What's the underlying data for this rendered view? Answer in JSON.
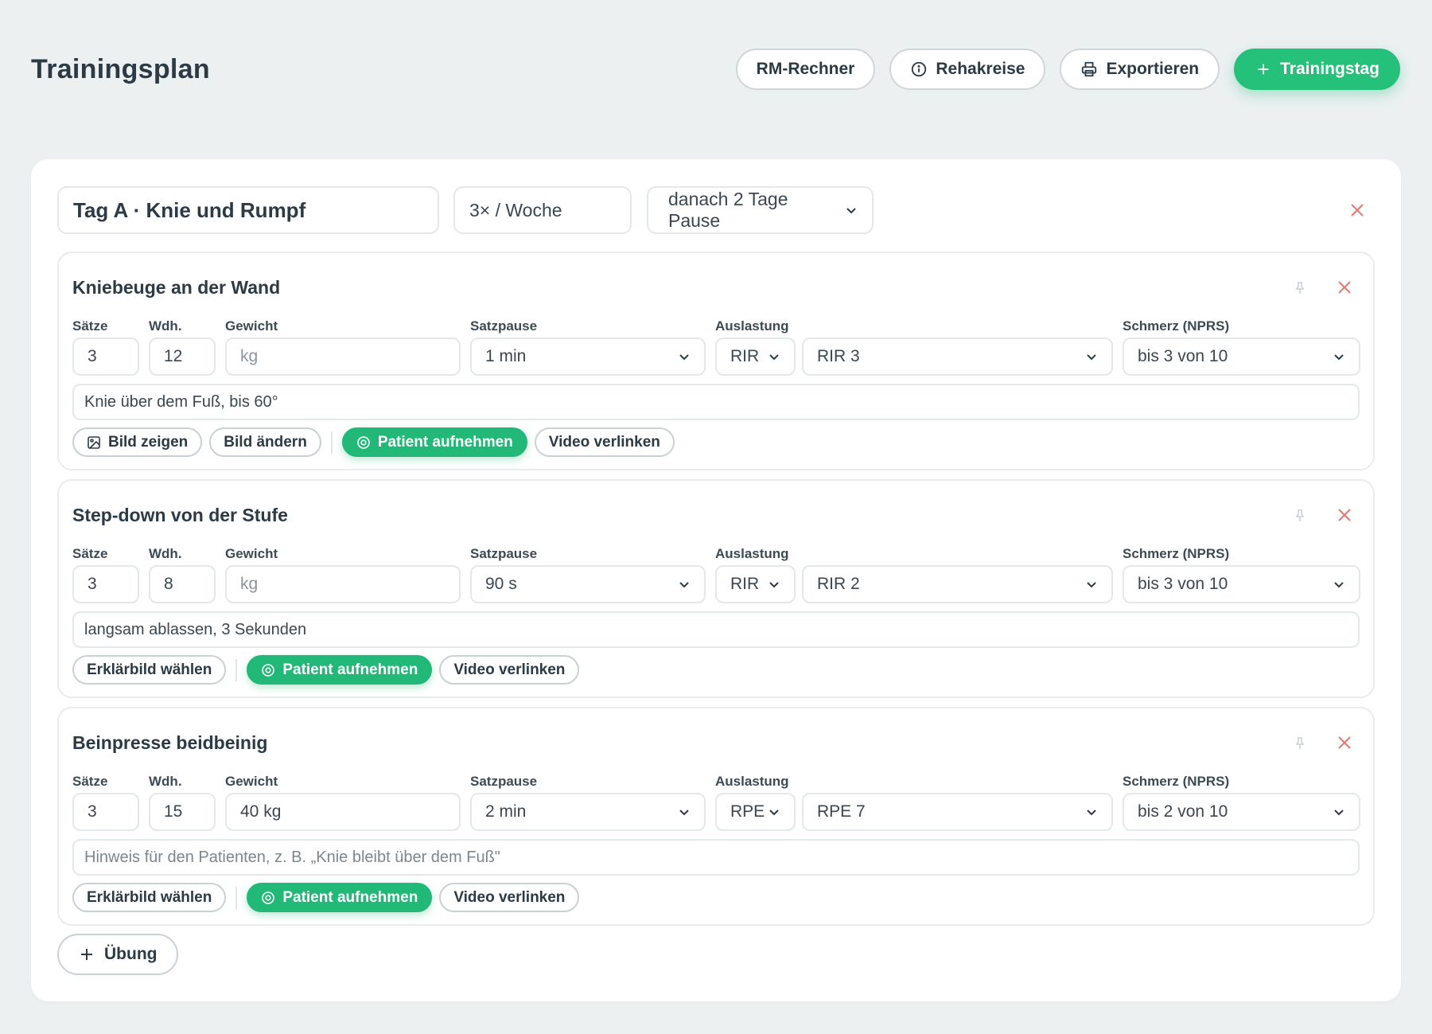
{
  "header": {
    "title": "Trainingsplan",
    "buttons": {
      "rm": "RM-Rechner",
      "rehakreise": "Rehakreise",
      "export": "Exportieren",
      "add_day": "Trainingstag"
    }
  },
  "day": {
    "name": "Tag A · Knie und Rumpf",
    "frequency": "3× / Woche",
    "pause": "danach 2 Tage Pause"
  },
  "labels": {
    "sets": "Sätze",
    "reps": "Wdh.",
    "weight": "Gewicht",
    "rest": "Satzpause",
    "load": "Auslastung",
    "pain": "Schmerz (NPRS)"
  },
  "exercises": [
    {
      "title": "Kniebeuge an der Wand",
      "sets": "3",
      "reps": "12",
      "weight": "",
      "weight_placeholder": "kg",
      "rest": "1 min",
      "load_type": "RIR",
      "load_value": "RIR 3",
      "pain": "bis 3 von 10",
      "note": "Knie über dem Fuß, bis 60°",
      "note_placeholder": "",
      "buttons": {
        "show_image": "Bild zeigen",
        "change_image": "Bild ändern",
        "record": "Patient aufnehmen",
        "video": "Video verlinken"
      }
    },
    {
      "title": "Step-down von der Stufe",
      "sets": "3",
      "reps": "8",
      "weight": "",
      "weight_placeholder": "kg",
      "rest": "90 s",
      "load_type": "RIR",
      "load_value": "RIR 2",
      "pain": "bis 3 von 10",
      "note": "langsam ablassen, 3 Sekunden",
      "note_placeholder": "",
      "buttons": {
        "choose_image": "Erklärbild wählen",
        "record": "Patient aufnehmen",
        "video": "Video verlinken"
      }
    },
    {
      "title": "Beinpresse beidbeinig",
      "sets": "3",
      "reps": "15",
      "weight": "40 kg",
      "weight_placeholder": "kg",
      "rest": "2 min",
      "load_type": "RPE",
      "load_value": "RPE 7",
      "pain": "bis 2 von 10",
      "note": "",
      "note_placeholder": "Hinweis für den Patienten, z. B. „Knie bleibt über dem Fuß\"",
      "buttons": {
        "choose_image": "Erklärbild wählen",
        "record": "Patient aufnehmen",
        "video": "Video verlinken"
      }
    }
  ],
  "add_exercise": "Übung",
  "colors": {
    "accent": "#25c07a",
    "danger": "#e07a72",
    "background": "#ecf0f1"
  }
}
